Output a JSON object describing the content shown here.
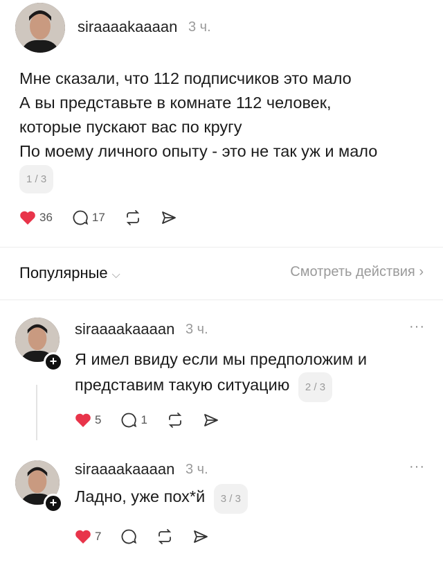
{
  "post": {
    "username": "siraaaakaaaan",
    "time": "3 ч.",
    "lines": [
      "Мне сказали, что 112 подписчиков это мало",
      "А вы представьте в комнате 112 человек,",
      "которые пускают вас по кругу",
      "По моему личного опыту - это не так уж и мало"
    ],
    "page": "1 / 3",
    "likes": "36",
    "comments": "17"
  },
  "bar": {
    "popular_label": "Популярные",
    "view_activity_label": "Смотреть действия"
  },
  "replies": [
    {
      "username": "siraaaakaaaan",
      "time": "3 ч.",
      "lines": [
        "Я имел ввиду если мы предположим и",
        "представим такую ситуацию"
      ],
      "page": "2 / 3",
      "likes": "5",
      "comments": "1"
    },
    {
      "username": "siraaaakaaaan",
      "time": "3 ч.",
      "lines": [
        "Ладно, уже пох*й"
      ],
      "page": "3 / 3",
      "likes": "7",
      "comments": ""
    }
  ],
  "colors": {
    "like": "#e8344a",
    "muted": "#9a9a9a"
  },
  "icons": [
    "heart-icon",
    "comment-icon",
    "repost-icon",
    "share-icon",
    "chevron-down-icon",
    "chevron-right-icon",
    "more-icon",
    "follow-plus-icon"
  ]
}
